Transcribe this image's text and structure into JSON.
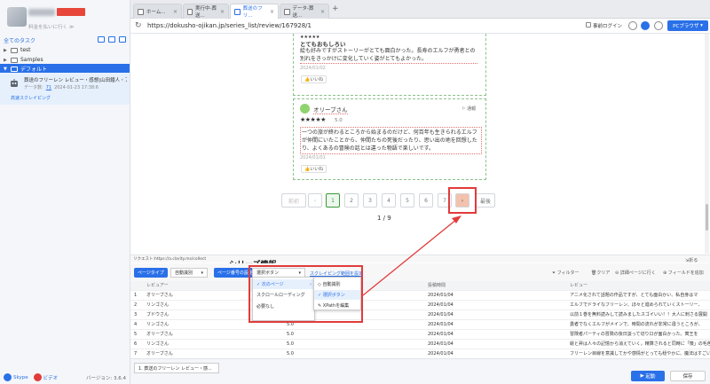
{
  "sidebar": {
    "user_sub": "料金を払いに行く ≫",
    "tasks_header": "全てのタスク",
    "tree": [
      {
        "label": "test"
      },
      {
        "label": "Samples"
      },
      {
        "label": "デフォルト"
      }
    ],
    "task": {
      "title": "葬送のフリーレン レビュー・感想|山田鐘人・アベツカサ",
      "meta_label": "データ数:",
      "meta_count": "71",
      "meta_time": "2024-01-23 17:38:6",
      "action": "高速スクレイピング"
    },
    "footer": {
      "skype": "Skype",
      "video": "ビデオ",
      "version": "バージョン: 3.6.4"
    }
  },
  "tabs": [
    {
      "label": "ホーム..."
    },
    {
      "label": "実行中-葬送..."
    },
    {
      "label": "葬送のフリ..."
    },
    {
      "label": "データ-葬送..."
    }
  ],
  "urlbar": {
    "url": "https://dokusho-ojikan.jp/series_list/review/167928/1",
    "login": "事前ログイン",
    "pc_browser": "PCブラウザ"
  },
  "reviews": [
    {
      "headline": "とてもおもしろい",
      "text": "絵も好みですがストーリーがとても面白かった。長寿のエルフが勇者との別れをきっかけに変化していく姿がとてもよかった。",
      "date": "2024/01/02",
      "like": "いいね"
    },
    {
      "name": "オリーブさん",
      "report": "通報",
      "rating": "5.0",
      "text": "一つの旅が終わるところから始まるのだけど、何百年も生きられるエルフが仲間にいたことから、仲間たちの死後だったり、思い出の地を回想したり、よくあるの冒険の話とは違った物語で楽しいです。",
      "date": "2024/01/01",
      "like": "いいね"
    }
  ],
  "pagination": {
    "prev_text": "前初",
    "prev_arrow": "‹",
    "pages": [
      "1",
      "2",
      "3",
      "4",
      "5",
      "6",
      "7"
    ],
    "next_arrow": "›",
    "last_text": "最後",
    "count": "1 / 9"
  },
  "request_line": "リクエスト:https://a.clarity.ms/collect",
  "collapse": "折る",
  "series_title": "シリーズ情報",
  "toolbar": {
    "page_type": "ページタイプ",
    "auto_detect": "自動識別",
    "page_setting": "ページ番号の設定",
    "select_button": "選択ボタン",
    "scrape_range": "スクレイピング範囲を設定",
    "filter": "フィルター",
    "clear": "クリア",
    "detail": "詳細ページに行く",
    "add_field": "フィールドを追加"
  },
  "dropdown": {
    "left": [
      "次のページ",
      "スクロールローディング",
      "必要なし"
    ],
    "right": [
      "自動識別",
      "選択ボタン",
      "XPathを編集"
    ]
  },
  "table": {
    "headers": [
      "",
      "レビュアー",
      "評価",
      "投稿時間",
      "レビュー"
    ],
    "rows": [
      [
        "1",
        "オリーブさん",
        "5.0",
        "2024/01/04",
        "アニメ化されて話題の作品ですが、とても面白かい、私自身はマ"
      ],
      [
        "2",
        "リンゴさん",
        "5.0",
        "2024/01/04",
        "エルフでドライなフリーレン、ほ々と進められていくストーリー、"
      ],
      [
        "3",
        "ブドウさん",
        "5.0",
        "2024/01/04",
        "以前１巻を無料読みして読みましたスゴイいい！！大人に刺さる展開"
      ],
      [
        "4",
        "リンゴさん",
        "5.0",
        "2024/01/04",
        "勇者でなくエルフがメインで、時間の流れが非常に違うところが、"
      ],
      [
        "5",
        "オリーブさん",
        "5.0",
        "2024/01/04",
        "冒険者パーティの冒険の後日談って切り口が面白かった。寓王を"
      ],
      [
        "6",
        "リンゴさん",
        "5.0",
        "2024/01/04",
        "絵と昇は人々の記憶から消えていく。精算されると同時に「懐」の毛色"
      ],
      [
        "7",
        "オリーブさん",
        "5.0",
        "2024/01/04",
        "フリーレン目線を意識してかや感情がとっても穏やかに、魔法はすごい"
      ]
    ]
  },
  "status": {
    "tab_label": "1. 葬送のフリーレン レビュー・感...",
    "run": "起動",
    "save": "保存"
  },
  "colors": {
    "accent": "#2a70e8",
    "highlight": "#e23b3b",
    "active_page": "#3a9a3a"
  }
}
